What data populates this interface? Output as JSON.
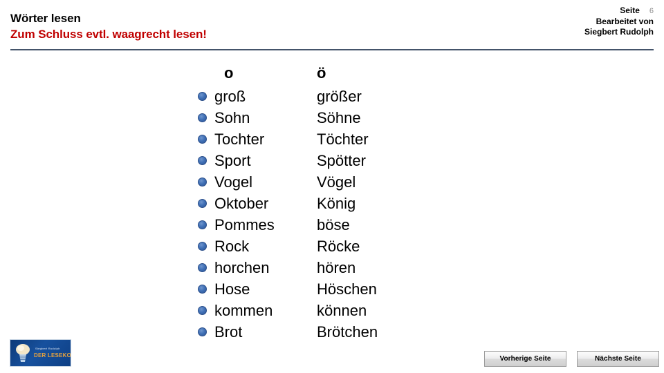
{
  "header": {
    "title": "Wörter lesen",
    "subtitle": "Zum Schluss evtl. waagrecht lesen!",
    "page_label": "Seite",
    "page_number": "6",
    "editor_prefix": "Bearbeitet von",
    "editor_name": "Siegbert Rudolph",
    "rule_color": "#44546a",
    "subtitle_color": "#c00000"
  },
  "table": {
    "columns": [
      {
        "header": "o"
      },
      {
        "header": "ö"
      }
    ],
    "rows": [
      {
        "left": "groß",
        "right": "größer"
      },
      {
        "left": "Sohn",
        "right": "Söhne"
      },
      {
        "left": "Tochter",
        "right": "Töchter"
      },
      {
        "left": "Sport",
        "right": "Spötter"
      },
      {
        "left": "Vogel",
        "right": "Vögel"
      },
      {
        "left": "Oktober",
        "right": "König"
      },
      {
        "left": "Pommes",
        "right": "böse"
      },
      {
        "left": "Rock",
        "right": "Röcke"
      },
      {
        "left": "horchen",
        "right": "hören"
      },
      {
        "left": "Hose",
        "right": "Höschen"
      },
      {
        "left": "kommen",
        "right": "können"
      },
      {
        "left": "Brot",
        "right": "Brötchen"
      }
    ],
    "bullet_color": "#3f6fb5"
  },
  "logo": {
    "text_top": "Siegbert Rudolph",
    "text_main": "DER LESEKOCH"
  },
  "footer": {
    "prev_button": "Vorherige Seite",
    "next_button": "Nächste Seite"
  }
}
